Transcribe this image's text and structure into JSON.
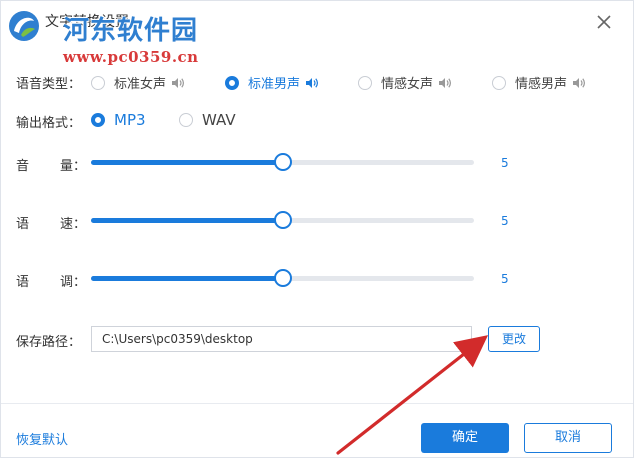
{
  "dialog": {
    "title": "文字转换设置",
    "watermark": {
      "site_name": "河东软件园",
      "site_url": "www.pc0359.cn"
    }
  },
  "voice": {
    "label": "语音类型：",
    "options": [
      {
        "label": "标准女声",
        "selected": false
      },
      {
        "label": "标准男声",
        "selected": true
      },
      {
        "label": "情感女声",
        "selected": false
      },
      {
        "label": "情感男声",
        "selected": false
      }
    ]
  },
  "format": {
    "label": "输出格式：",
    "options": [
      {
        "label": "MP3",
        "selected": true
      },
      {
        "label": "WAV",
        "selected": false
      }
    ]
  },
  "sliders": [
    {
      "label_a": "音",
      "label_b": "量：",
      "value": "5",
      "level": 0.5
    },
    {
      "label_a": "语",
      "label_b": "速：",
      "value": "5",
      "level": 0.5
    },
    {
      "label_a": "语",
      "label_b": "调：",
      "value": "5",
      "level": 0.5
    }
  ],
  "path": {
    "label": "保存路径：",
    "value": "C:\\Users\\pc0359\\desktop",
    "change_label": "更改"
  },
  "footer": {
    "restore_label": "恢复默认",
    "ok_label": "确定",
    "cancel_label": "取消"
  },
  "colors": {
    "accent": "#1a7bdc",
    "annotation_arrow": "#d22b2b"
  },
  "icons": {
    "close": "close-icon",
    "speaker": "speaker-icon",
    "logo": "site-logo-icon"
  }
}
